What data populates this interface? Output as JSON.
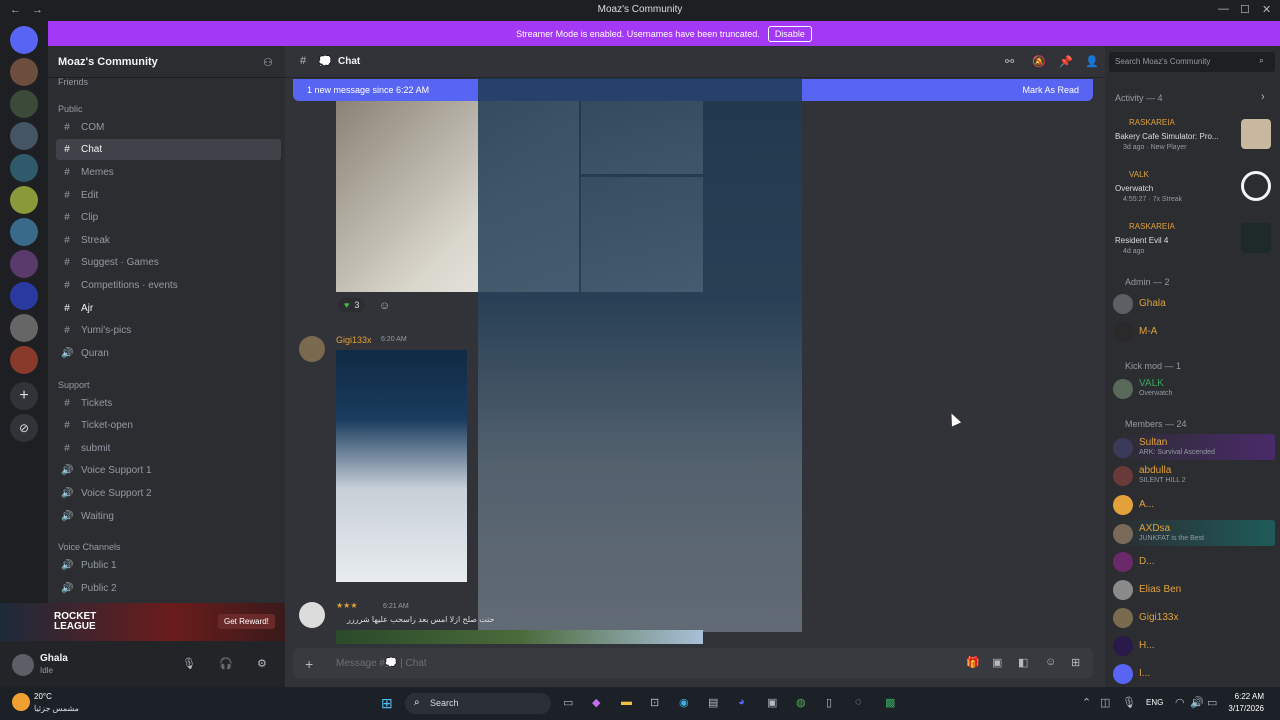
{
  "window": {
    "title": "Moaz's Community"
  },
  "banner": {
    "text": "Streamer Mode is enabled. Usernames have been truncated.",
    "button": "Disable"
  },
  "server": {
    "name": "Moaz's Community"
  },
  "sidebar": {
    "categories": {
      "friends": "Friends",
      "public": "Public",
      "support": "Support",
      "voice": "Voice Channels"
    },
    "channels": [
      {
        "label": "COM",
        "hash": "#"
      },
      {
        "label": "Chat",
        "hash": "#"
      },
      {
        "label": "Memes",
        "hash": "#"
      },
      {
        "label": "Edit",
        "hash": "#"
      },
      {
        "label": "Clip",
        "hash": "#"
      },
      {
        "label": "Streak",
        "hash": "#"
      },
      {
        "label": "Suggest · Games",
        "hash": "#"
      },
      {
        "label": "Competitions · events",
        "hash": "#"
      },
      {
        "label": "Ajr",
        "hash": "#"
      },
      {
        "label": "Yumi's-pics",
        "hash": "#"
      },
      {
        "label": "Quran",
        "hash": "🔊"
      }
    ],
    "support": [
      {
        "label": "Tickets",
        "hash": "#"
      },
      {
        "label": "Ticket-open",
        "hash": "#"
      },
      {
        "label": "submit",
        "hash": "#"
      },
      {
        "label": "Voice Support 1",
        "hash": "🔊"
      },
      {
        "label": "Voice Support 2",
        "hash": "🔊"
      },
      {
        "label": "Waiting",
        "hash": "🔊"
      }
    ],
    "voice": [
      {
        "label": "Public 1",
        "hash": "🔊"
      },
      {
        "label": "Public 2",
        "hash": "🔊"
      }
    ]
  },
  "promo": {
    "game": "ROCKET LEAGUE",
    "button": "Get Reward!"
  },
  "user": {
    "name": "Ghala",
    "status": "Idle"
  },
  "header": {
    "channel": "Chat",
    "search_placeholder": "Search Moaz's Community"
  },
  "newmsg": {
    "text": "1 new message since 6:22 AM",
    "action": "Mark As Read"
  },
  "messages": {
    "reaction_count": "3",
    "author": "Gigi133x",
    "time": "6:20 AM",
    "author2": "★★★",
    "time2": "6:21 AM",
    "arabic": "حتت صلح ازلا امس بعد راسحب عليها شرررر"
  },
  "composer": {
    "placeholder": "Message #💭 | Chat"
  },
  "activity": {
    "title": "Activity — 4",
    "items": [
      {
        "user": "RASKAREIA",
        "game": "Bakery Cafe Simulator: Pro...",
        "meta": "3d ago · New Player"
      },
      {
        "user": "VALK",
        "game": "Overwatch",
        "meta": "4:55:27 · 7x Streak"
      },
      {
        "user": "RASKAREIA",
        "game": "Resident Evil 4",
        "meta": "4d ago"
      }
    ]
  },
  "members": {
    "admin_header": "Admin — 2",
    "admins": [
      {
        "name": "Ghala"
      },
      {
        "name": "M-A"
      }
    ],
    "kick_header": "Kick mod — 1",
    "kick": [
      {
        "name": "VALK",
        "sub": "Overwatch"
      }
    ],
    "members_header": "Members — 24",
    "list": [
      {
        "name": "Sultan",
        "sub": "ARK: Survival Ascended"
      },
      {
        "name": "abdulla",
        "sub": "SILENT HILL 2"
      },
      {
        "name": "A...",
        "sub": ""
      },
      {
        "name": "AXDsa",
        "sub": "JUNKFAT is the Best"
      },
      {
        "name": "D...",
        "sub": ""
      },
      {
        "name": "Elias Ben",
        "sub": ""
      },
      {
        "name": "Gigi133x",
        "sub": ""
      },
      {
        "name": "H...",
        "sub": ""
      },
      {
        "name": "I...",
        "sub": ""
      }
    ]
  },
  "taskbar": {
    "weather_temp": "20°C",
    "weather_text": "مشمس جزئيا",
    "search": "Search",
    "lang": "ENG",
    "time": "6:22 AM",
    "date": "3/17/2026"
  }
}
